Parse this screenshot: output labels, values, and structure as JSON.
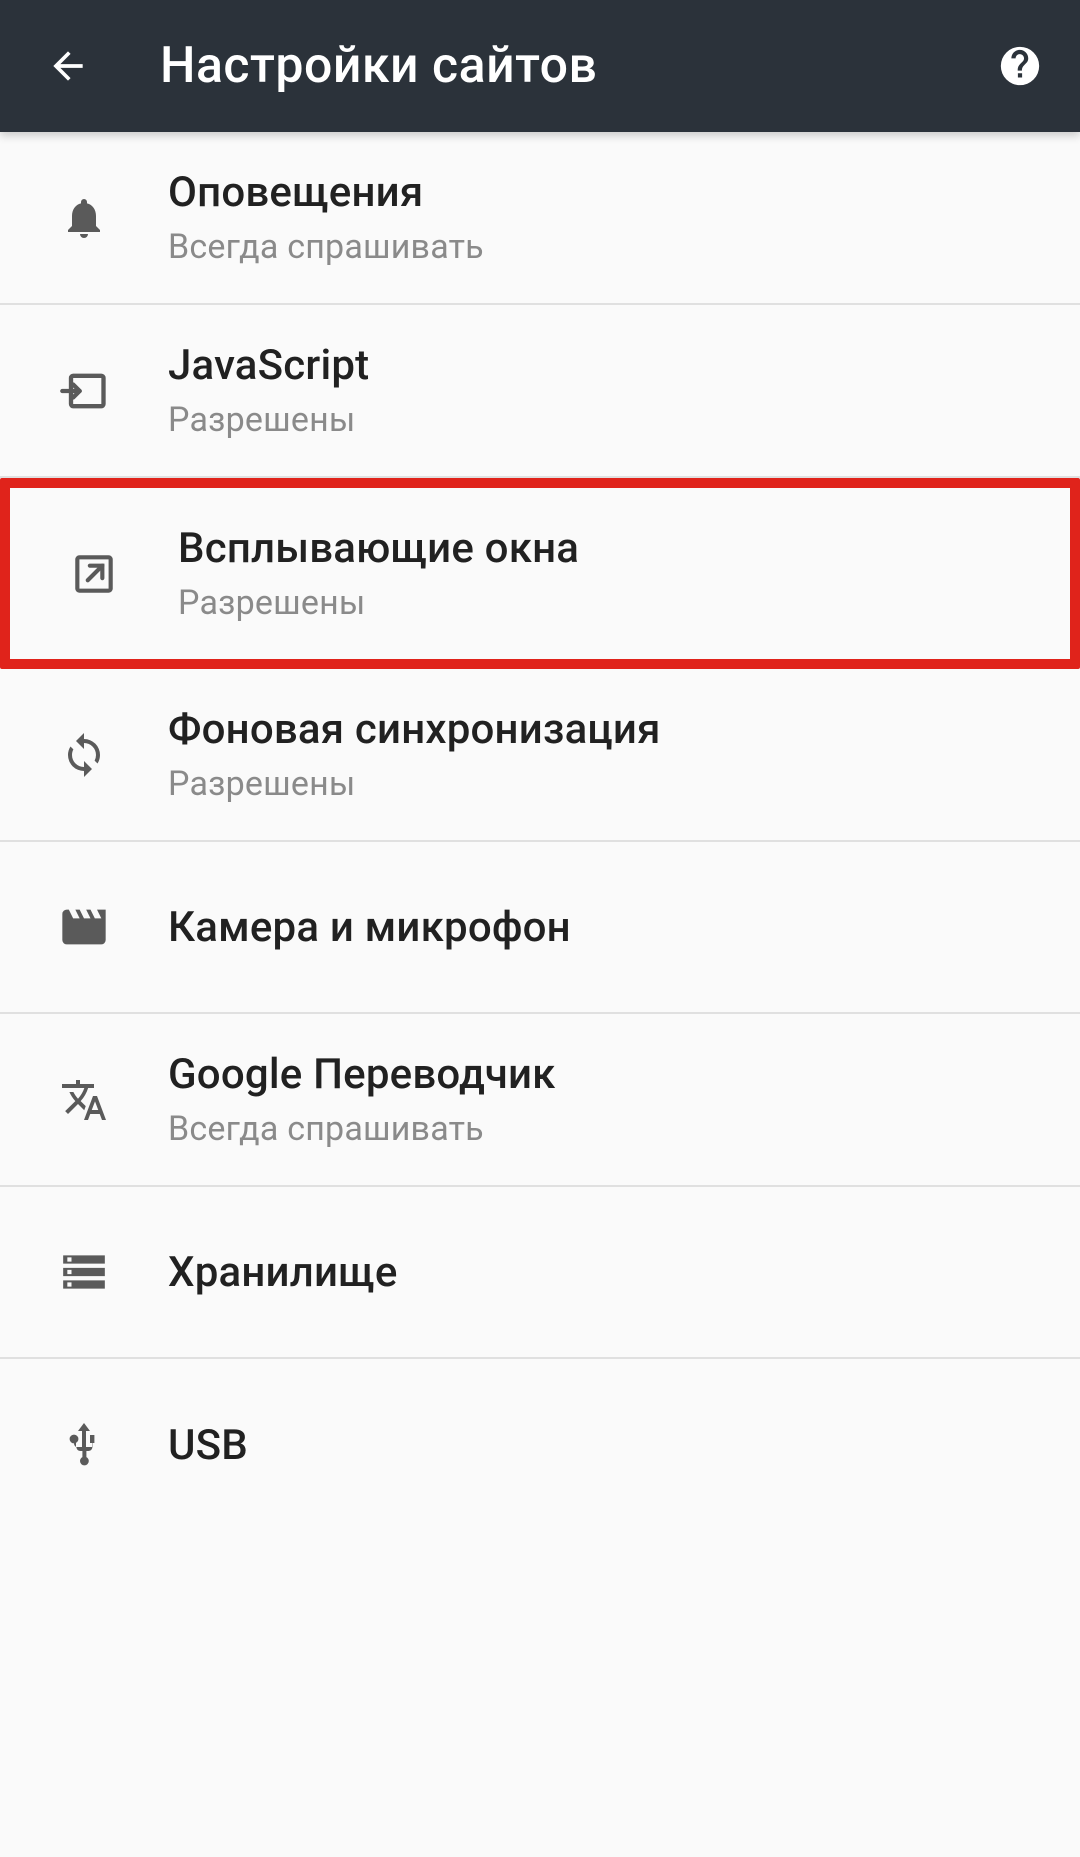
{
  "header": {
    "title": "Настройки сайтов"
  },
  "items": [
    {
      "icon": "bell",
      "title": "Оповещения",
      "sub": "Всегда спрашивать",
      "highlighted": false
    },
    {
      "icon": "javascript",
      "title": "JavaScript",
      "sub": "Разрешены",
      "highlighted": false
    },
    {
      "icon": "popup",
      "title": "Всплывающие окна",
      "sub": "Разрешены",
      "highlighted": true
    },
    {
      "icon": "sync",
      "title": "Фоновая синхронизация",
      "sub": "Разрешены",
      "highlighted": false
    },
    {
      "icon": "camera",
      "title": "Камера и микрофон",
      "sub": "",
      "highlighted": false
    },
    {
      "icon": "translate",
      "title": "Google Переводчик",
      "sub": "Всегда спрашивать",
      "highlighted": false
    },
    {
      "icon": "storage",
      "title": "Хранилище",
      "sub": "",
      "highlighted": false
    },
    {
      "icon": "usb",
      "title": "USB",
      "sub": "",
      "highlighted": false
    }
  ]
}
